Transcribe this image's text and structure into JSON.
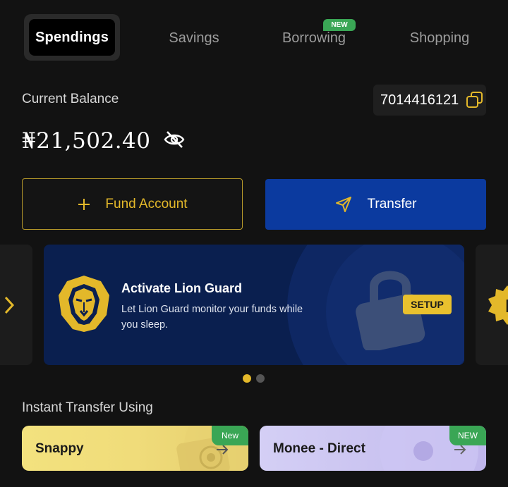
{
  "tabs": {
    "spendings": "Spendings",
    "savings": "Savings",
    "borrowing": "Borrowing",
    "borrowing_badge": "NEW",
    "shopping": "Shopping"
  },
  "balance": {
    "label": "Current Balance",
    "account_number": "7014416121",
    "amount": "₦21,502.40"
  },
  "actions": {
    "fund": "Fund Account",
    "transfer": "Transfer"
  },
  "promo": {
    "title": "Activate Lion Guard",
    "description": "Let Lion Guard monitor your funds while you sleep.",
    "button": "SETUP"
  },
  "instant": {
    "title": "Instant Transfer Using",
    "cards": [
      {
        "label": "Snappy",
        "badge": "New"
      },
      {
        "label": "Monee - Direct",
        "badge": "NEW"
      }
    ]
  },
  "colors": {
    "accent_gold": "#e3b82a",
    "transfer_blue": "#0b3a9f",
    "badge_green": "#3aa655",
    "background": "#121212"
  },
  "icons": [
    "copy-icon",
    "eye-off-icon",
    "plus-icon",
    "send-icon",
    "chevron-right-icon",
    "lion-icon",
    "lock-icon"
  ],
  "carousel": {
    "active_index": 0,
    "total": 2
  }
}
